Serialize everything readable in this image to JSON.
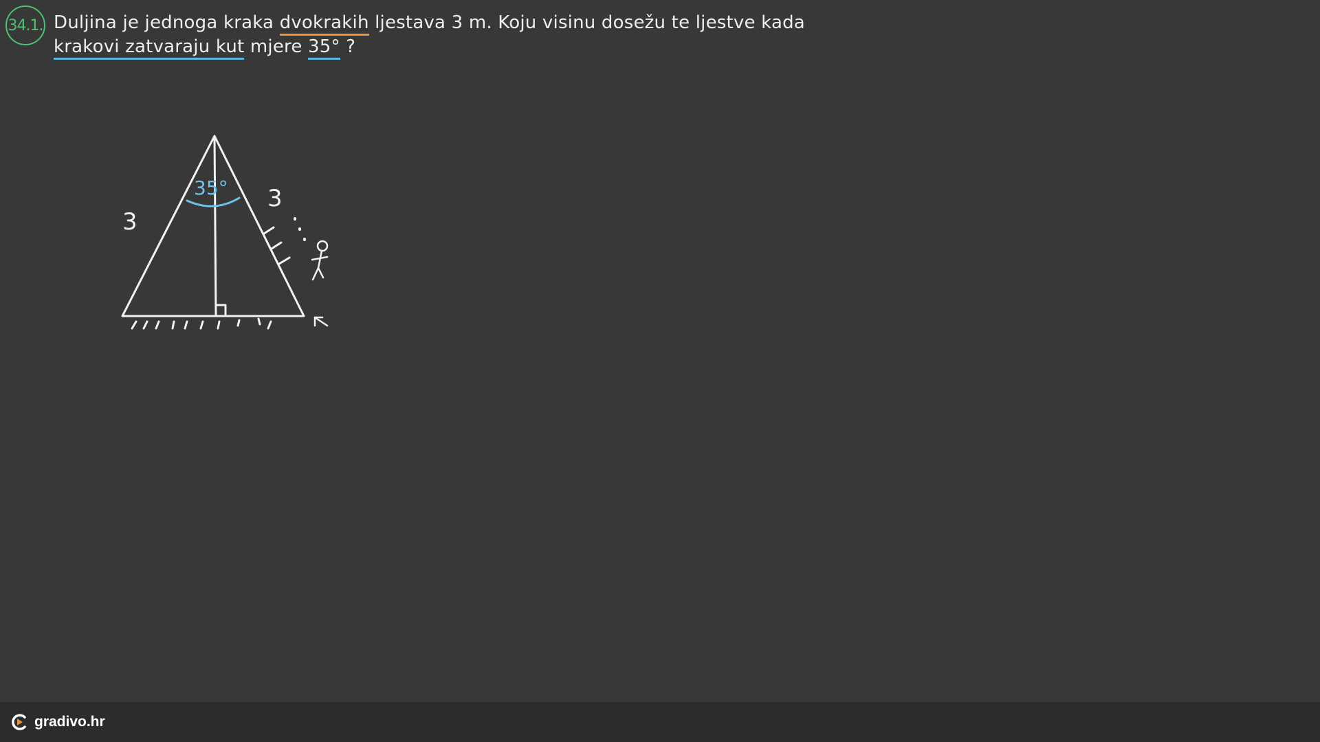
{
  "problem": {
    "number": "34.1.",
    "text_part1": "Duljina je jednoga kraka ",
    "highlight_dvokrakih": "dvokrakih",
    "text_part2": " ljestava 3 m. Koju visinu dosežu te ljestve kada",
    "highlight_krakovi": "krakovi zatvaraju kut",
    "text_part3": " mjere ",
    "highlight_angle": "35°",
    "text_part4": " ?"
  },
  "sketch": {
    "left_side_label": "3",
    "right_side_label": "3",
    "apex_angle_label": "35°",
    "colors": {
      "chalk": "#f2f2f2",
      "angle": "#6cc3e6",
      "badge": "#4fbf72",
      "underline_orange": "#f0913a",
      "underline_blue": "#5fb6dc"
    }
  },
  "footer": {
    "brand": "gradivo.hr",
    "logo_icon": "gradivo-logo-icon"
  }
}
